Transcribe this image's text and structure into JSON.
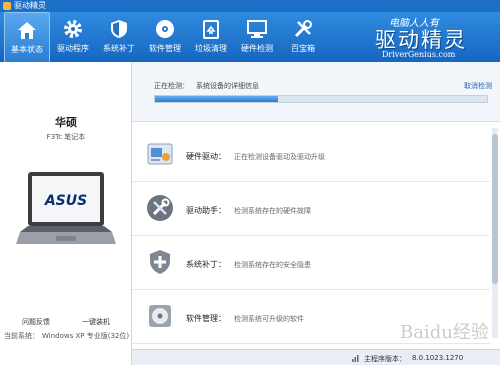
{
  "window": {
    "title": "驱动精灵"
  },
  "toolbar": {
    "tabs": [
      {
        "label": "基本状态",
        "icon": "home-icon"
      },
      {
        "label": "驱动程序",
        "icon": "gear-icon"
      },
      {
        "label": "系统补丁",
        "icon": "shield-icon"
      },
      {
        "label": "软件管理",
        "icon": "disc-icon"
      },
      {
        "label": "垃圾清理",
        "icon": "trash-icon"
      },
      {
        "label": "硬件检测",
        "icon": "monitor-icon"
      },
      {
        "label": "百宝箱",
        "icon": "tools-icon"
      }
    ],
    "active_tab": 0
  },
  "brand": {
    "tagline": "电脑人人有",
    "name": "驱动精灵",
    "url": "DriverGenius.com"
  },
  "device": {
    "name": "华硕",
    "model": "F3Tc 笔记本",
    "screen_logo": "ASUS"
  },
  "left_buttons": {
    "feedback": "问题反馈",
    "one_click": "一键装机"
  },
  "system": {
    "label": "当前系统：",
    "value": "Windows XP 专业版(32位)"
  },
  "scan": {
    "label": "正在检测：",
    "text": "系统设备的详细信息",
    "cancel": "取消检测",
    "progress": 0.37
  },
  "rows": [
    {
      "title": "硬件驱动：",
      "desc": "正在检测设备驱动及驱动升级",
      "icon": "hardware-driver-icon"
    },
    {
      "title": "驱动助手：",
      "desc": "检测系统存在的硬件故障",
      "icon": "wrench-screwdriver-icon"
    },
    {
      "title": "系统补丁：",
      "desc": "检测系统存在的安全隐患",
      "icon": "shield-plus-icon"
    },
    {
      "title": "软件管理：",
      "desc": "检测系统可升级的软件",
      "icon": "software-disc-icon"
    }
  ],
  "status": {
    "label": "主程序版本：",
    "version": "8.0.1023.1270"
  },
  "watermark": "Baidu经验"
}
